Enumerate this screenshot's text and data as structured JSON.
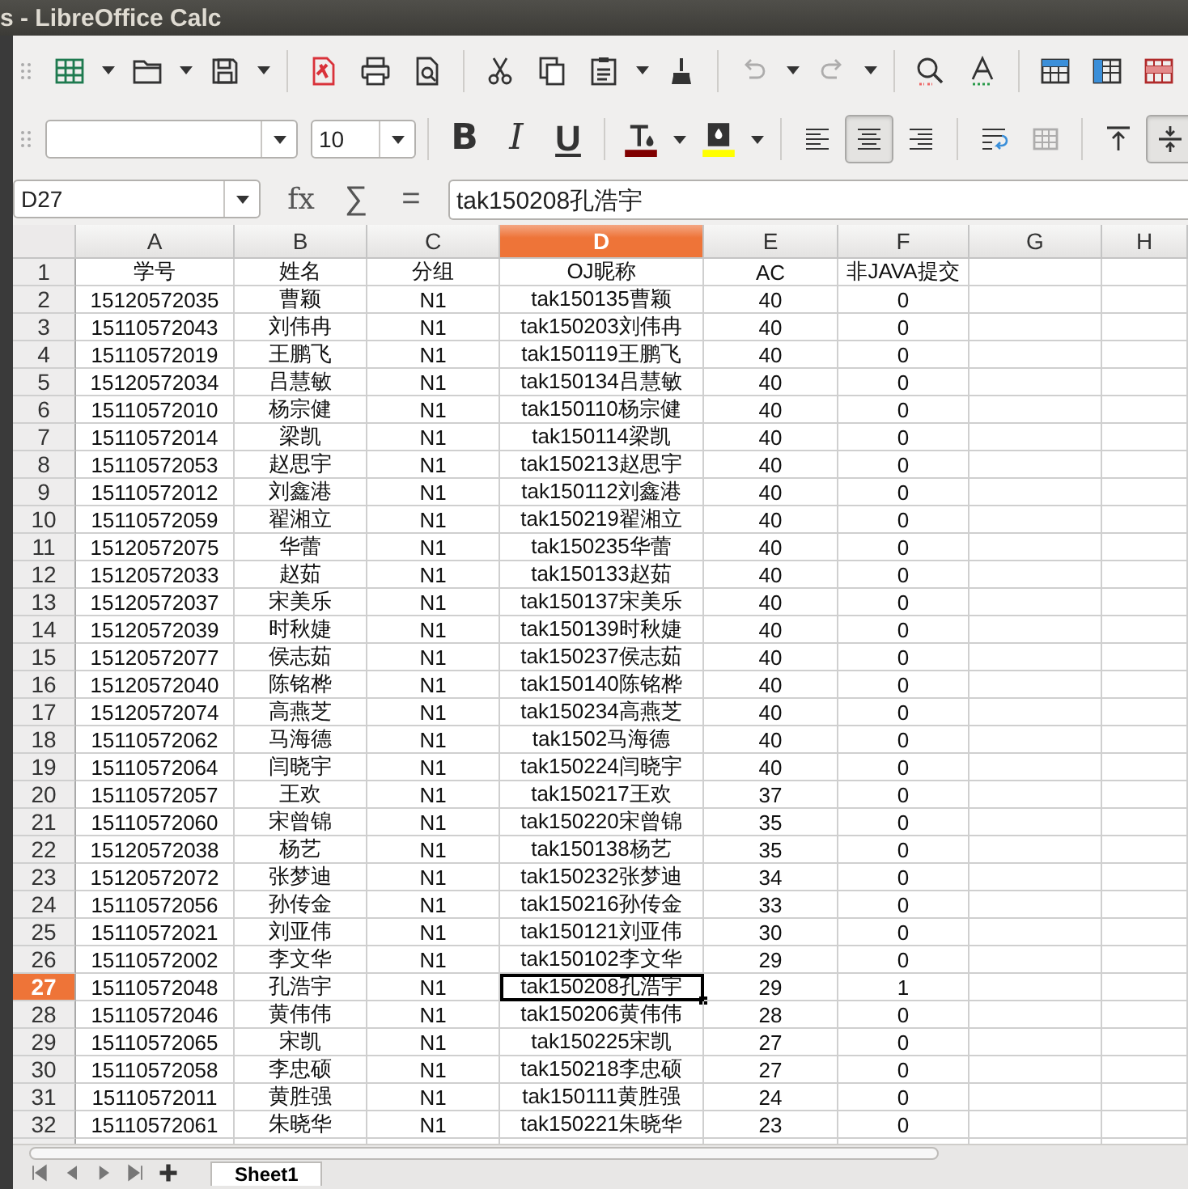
{
  "window": {
    "title": "s - LibreOffice Calc"
  },
  "standard_toolbar": [
    {
      "kind": "new-sheet",
      "dropdown": true,
      "disabled": false
    },
    {
      "kind": "open",
      "dropdown": true,
      "disabled": false
    },
    {
      "kind": "save",
      "dropdown": true,
      "disabled": false
    },
    {
      "kind": "separator"
    },
    {
      "kind": "pdf",
      "disabled": false
    },
    {
      "kind": "print",
      "disabled": false
    },
    {
      "kind": "preview",
      "disabled": false
    },
    {
      "kind": "separator"
    },
    {
      "kind": "cut",
      "disabled": false
    },
    {
      "kind": "copy",
      "disabled": false
    },
    {
      "kind": "paste",
      "dropdown": true,
      "disabled": false
    },
    {
      "kind": "brush",
      "disabled": false
    },
    {
      "kind": "separator"
    },
    {
      "kind": "undo",
      "dropdown": true,
      "disabled": true
    },
    {
      "kind": "redo",
      "dropdown": true,
      "disabled": true
    },
    {
      "kind": "separator"
    },
    {
      "kind": "find",
      "disabled": false
    },
    {
      "kind": "spelling",
      "disabled": false
    },
    {
      "kind": "separator"
    },
    {
      "kind": "insert-row",
      "disabled": false
    },
    {
      "kind": "insert-column",
      "disabled": false
    },
    {
      "kind": "delete-row",
      "disabled": false
    }
  ],
  "formatting_toolbar": [
    {
      "kind": "font-name"
    },
    {
      "kind": "font-size",
      "value": "10"
    },
    {
      "kind": "separator"
    },
    {
      "kind": "bold",
      "glyph": "B",
      "pressed": false
    },
    {
      "kind": "italic",
      "glyph": "I",
      "pressed": false
    },
    {
      "kind": "underline",
      "glyph": "U",
      "pressed": false
    },
    {
      "kind": "separator"
    },
    {
      "kind": "font-color",
      "color": "#800000"
    },
    {
      "kind": "highlight",
      "color": "#ffff00"
    },
    {
      "kind": "separator"
    },
    {
      "kind": "align-left",
      "pressed": false
    },
    {
      "kind": "align-center",
      "pressed": true
    },
    {
      "kind": "align-right",
      "pressed": false
    },
    {
      "kind": "separator"
    },
    {
      "kind": "wrap",
      "pressed": false,
      "disabled": false
    },
    {
      "kind": "merge",
      "pressed": false,
      "disabled": true
    },
    {
      "kind": "separator"
    },
    {
      "kind": "align-top",
      "pressed": false
    },
    {
      "kind": "align-middle",
      "pressed": true
    }
  ],
  "formula_bar": {
    "name_box": "D27",
    "buttons": [
      {
        "kind": "function",
        "glyph": "fx"
      },
      {
        "kind": "sum",
        "glyph": "∑"
      },
      {
        "kind": "formula",
        "glyph": "="
      }
    ],
    "content": "tak150208孔浩宇"
  },
  "sheet": {
    "columns": [
      {
        "label": "A",
        "selected": false
      },
      {
        "label": "B",
        "selected": false
      },
      {
        "label": "C",
        "selected": false
      },
      {
        "label": "D",
        "selected": true
      },
      {
        "label": "E",
        "selected": false
      },
      {
        "label": "F",
        "selected": false
      },
      {
        "label": "G",
        "selected": false
      },
      {
        "label": "H",
        "selected": false
      }
    ],
    "rows": [
      {
        "number": "1",
        "selected": false,
        "cells": [
          "学号",
          "姓名",
          "分组",
          "OJ昵称",
          "AC",
          "非JAVA提交"
        ]
      },
      {
        "number": "2",
        "selected": false,
        "cells": [
          "15120572035",
          "曹颖",
          "N1",
          "tak150135曹颖",
          "40",
          "0"
        ]
      },
      {
        "number": "3",
        "selected": false,
        "cells": [
          "15110572043",
          "刘伟冉",
          "N1",
          "tak150203刘伟冉",
          "40",
          "0"
        ]
      },
      {
        "number": "4",
        "selected": false,
        "cells": [
          "15110572019",
          "王鹏飞",
          "N1",
          "tak150119王鹏飞",
          "40",
          "0"
        ]
      },
      {
        "number": "5",
        "selected": false,
        "cells": [
          "15120572034",
          "吕慧敏",
          "N1",
          "tak150134吕慧敏",
          "40",
          "0"
        ]
      },
      {
        "number": "6",
        "selected": false,
        "cells": [
          "15110572010",
          "杨宗健",
          "N1",
          "tak150110杨宗健",
          "40",
          "0"
        ]
      },
      {
        "number": "7",
        "selected": false,
        "cells": [
          "15110572014",
          "梁凯",
          "N1",
          "tak150114梁凯",
          "40",
          "0"
        ]
      },
      {
        "number": "8",
        "selected": false,
        "cells": [
          "15110572053",
          "赵思宇",
          "N1",
          "tak150213赵思宇",
          "40",
          "0"
        ]
      },
      {
        "number": "9",
        "selected": false,
        "cells": [
          "15110572012",
          "刘鑫港",
          "N1",
          "tak150112刘鑫港",
          "40",
          "0"
        ]
      },
      {
        "number": "10",
        "selected": false,
        "cells": [
          "15110572059",
          "翟湘立",
          "N1",
          "tak150219翟湘立",
          "40",
          "0"
        ]
      },
      {
        "number": "11",
        "selected": false,
        "cells": [
          "15120572075",
          "华蕾",
          "N1",
          "tak150235华蕾",
          "40",
          "0"
        ]
      },
      {
        "number": "12",
        "selected": false,
        "cells": [
          "15120572033",
          "赵茹",
          "N1",
          "tak150133赵茹",
          "40",
          "0"
        ]
      },
      {
        "number": "13",
        "selected": false,
        "cells": [
          "15120572037",
          "宋美乐",
          "N1",
          "tak150137宋美乐",
          "40",
          "0"
        ]
      },
      {
        "number": "14",
        "selected": false,
        "cells": [
          "15120572039",
          "时秋婕",
          "N1",
          "tak150139时秋婕",
          "40",
          "0"
        ]
      },
      {
        "number": "15",
        "selected": false,
        "cells": [
          "15120572077",
          "侯志茹",
          "N1",
          "tak150237侯志茹",
          "40",
          "0"
        ]
      },
      {
        "number": "16",
        "selected": false,
        "cells": [
          "15120572040",
          "陈铭桦",
          "N1",
          "tak150140陈铭桦",
          "40",
          "0"
        ]
      },
      {
        "number": "17",
        "selected": false,
        "cells": [
          "15120572074",
          "高燕芝",
          "N1",
          "tak150234高燕芝",
          "40",
          "0"
        ]
      },
      {
        "number": "18",
        "selected": false,
        "cells": [
          "15110572062",
          "马海德",
          "N1",
          "tak1502马海德",
          "40",
          "0"
        ]
      },
      {
        "number": "19",
        "selected": false,
        "cells": [
          "15110572064",
          "闫晓宇",
          "N1",
          "tak150224闫晓宇",
          "40",
          "0"
        ]
      },
      {
        "number": "20",
        "selected": false,
        "cells": [
          "15110572057",
          "王欢",
          "N1",
          "tak150217王欢",
          "37",
          "0"
        ]
      },
      {
        "number": "21",
        "selected": false,
        "cells": [
          "15110572060",
          "宋曾锦",
          "N1",
          "tak150220宋曾锦",
          "35",
          "0"
        ]
      },
      {
        "number": "22",
        "selected": false,
        "cells": [
          "15120572038",
          "杨艺",
          "N1",
          "tak150138杨艺",
          "35",
          "0"
        ]
      },
      {
        "number": "23",
        "selected": false,
        "cells": [
          "15120572072",
          "张梦迪",
          "N1",
          "tak150232张梦迪",
          "34",
          "0"
        ]
      },
      {
        "number": "24",
        "selected": false,
        "cells": [
          "15110572056",
          "孙传金",
          "N1",
          "tak150216孙传金",
          "33",
          "0"
        ]
      },
      {
        "number": "25",
        "selected": false,
        "cells": [
          "15110572021",
          "刘亚伟",
          "N1",
          "tak150121刘亚伟",
          "30",
          "0"
        ]
      },
      {
        "number": "26",
        "selected": false,
        "cells": [
          "15110572002",
          "李文华",
          "N1",
          "tak150102李文华",
          "29",
          "0"
        ]
      },
      {
        "number": "27",
        "selected": true,
        "cells": [
          "15110572048",
          "孔浩宇",
          "N1",
          "tak150208孔浩宇",
          "29",
          "1"
        ]
      },
      {
        "number": "28",
        "selected": false,
        "cells": [
          "15110572046",
          "黄伟伟",
          "N1",
          "tak150206黄伟伟",
          "28",
          "0"
        ]
      },
      {
        "number": "29",
        "selected": false,
        "cells": [
          "15110572065",
          "宋凯",
          "N1",
          "tak150225宋凯",
          "27",
          "0"
        ]
      },
      {
        "number": "30",
        "selected": false,
        "cells": [
          "15110572058",
          "李忠硕",
          "N1",
          "tak150218李忠硕",
          "27",
          "0"
        ]
      },
      {
        "number": "31",
        "selected": false,
        "cells": [
          "15110572011",
          "黄胜强",
          "N1",
          "tak150111黄胜强",
          "24",
          "0"
        ]
      },
      {
        "number": "32",
        "selected": false,
        "cells": [
          "15110572061",
          "朱晓华",
          "N1",
          "tak150221朱晓华",
          "23",
          "0"
        ]
      }
    ]
  },
  "sheet_tabs": [
    {
      "label": "Sheet1",
      "selected": true
    }
  ]
}
